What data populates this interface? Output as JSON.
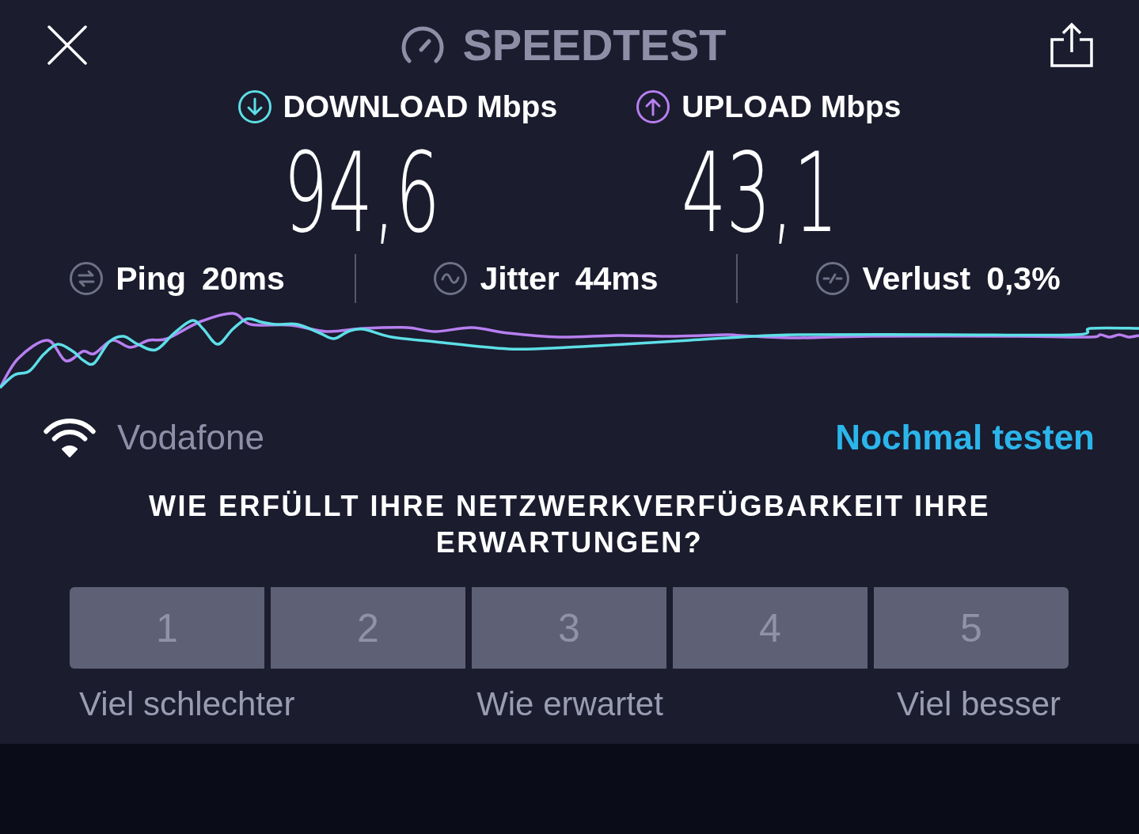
{
  "header": {
    "title": "SPEEDTEST"
  },
  "metrics": [
    {
      "kind": "download",
      "label": "DOWNLOAD Mbps",
      "value": "94,6",
      "color": "#5ddfe6"
    },
    {
      "kind": "upload",
      "label": "UPLOAD Mbps",
      "value": "43,1",
      "color": "#b77ff0"
    }
  ],
  "stats": [
    {
      "kind": "ping",
      "label": "Ping",
      "value": "20ms"
    },
    {
      "kind": "jitter",
      "label": "Jitter",
      "value": "44ms"
    },
    {
      "kind": "loss",
      "label": "Verlust",
      "value": "0,3%"
    }
  ],
  "network": {
    "name": "Vodafone",
    "retest_link": "Nochmal testen"
  },
  "survey": {
    "question": "WIE ERFÜLLT IHRE NETZWERKVERFÜGBARKEIT IHRE ERWARTUNGEN?",
    "options": [
      {
        "label": "1",
        "selected": false
      },
      {
        "label": "2",
        "selected": false
      },
      {
        "label": "3",
        "selected": false
      },
      {
        "label": "4",
        "selected": false
      },
      {
        "label": "5",
        "selected": false
      }
    ],
    "scale_labels": [
      "Viel schlechter",
      "Wie erwartet",
      "Viel besser"
    ]
  }
}
